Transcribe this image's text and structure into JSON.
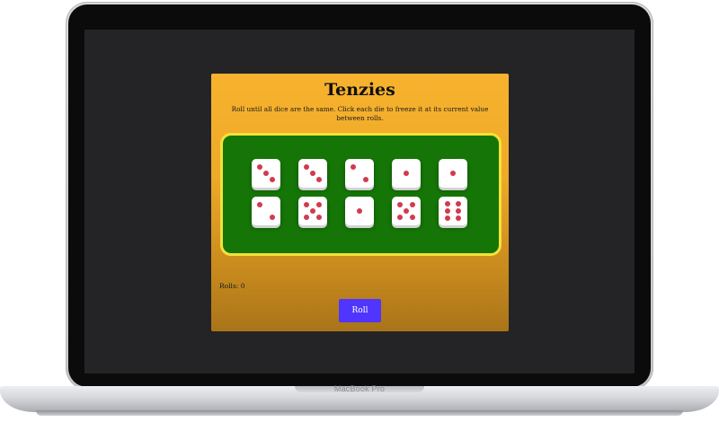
{
  "device": {
    "label": "MacBook Pro"
  },
  "app": {
    "title": "Tenzies",
    "instructions": "Roll until all dice are the same. Click each die to freeze it at its current value between rolls.",
    "rolls_text": "Rolls: 0",
    "roll_button_label": "Roll",
    "dice": [
      3,
      3,
      2,
      1,
      1,
      2,
      5,
      1,
      5,
      6
    ]
  },
  "colors": {
    "board": "#157506",
    "board_border": "#f4e13a",
    "pip": "#d23a4e",
    "button": "#5035ff"
  }
}
